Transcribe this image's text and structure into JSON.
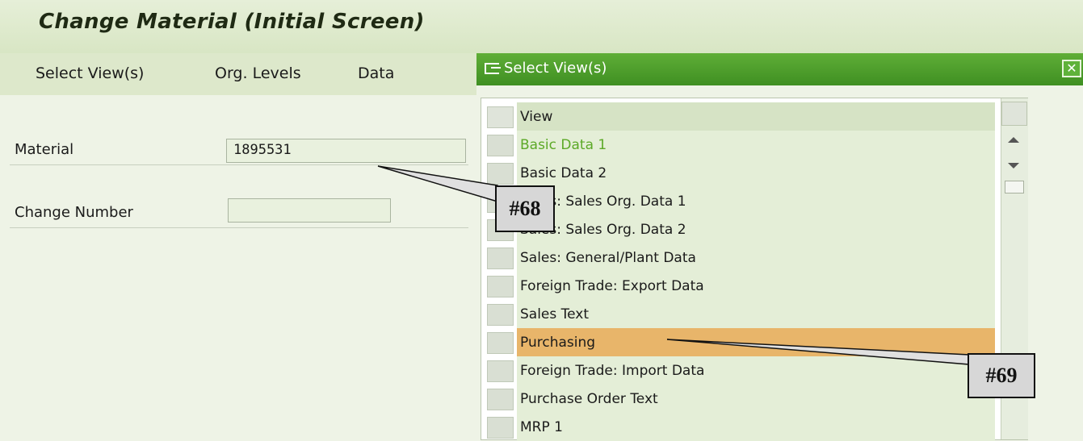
{
  "window": {
    "title": "Change Material (Initial Screen)"
  },
  "menu": {
    "items": [
      "Select View(s)",
      "Org. Levels",
      "Data"
    ]
  },
  "form": {
    "material_label": "Material",
    "material_value": "1895531",
    "change_number_label": "Change Number",
    "change_number_value": ""
  },
  "popup": {
    "title": "Select View(s)",
    "close_glyph": "✕",
    "column_header": "View",
    "rows": [
      {
        "label": "Basic Data 1",
        "state": "green"
      },
      {
        "label": "Basic Data 2",
        "state": "normal"
      },
      {
        "label": "Sales: Sales Org. Data 1",
        "state": "normal"
      },
      {
        "label": "Sales: Sales Org. Data 2",
        "state": "normal"
      },
      {
        "label": "Sales: General/Plant Data",
        "state": "normal"
      },
      {
        "label": "Foreign Trade: Export Data",
        "state": "normal"
      },
      {
        "label": "Sales Text",
        "state": "normal"
      },
      {
        "label": "Purchasing",
        "state": "highlighted"
      },
      {
        "label": "Foreign Trade: Import Data",
        "state": "normal"
      },
      {
        "label": "Purchase Order Text",
        "state": "normal"
      },
      {
        "label": "MRP 1",
        "state": "normal"
      }
    ]
  },
  "callouts": {
    "c68": "#68",
    "c69": "#69"
  },
  "colors": {
    "header_green": "#4a9a2a",
    "highlight": "#e8b56a",
    "basic_data_green": "#5ca927",
    "background": "#eef3e6"
  }
}
